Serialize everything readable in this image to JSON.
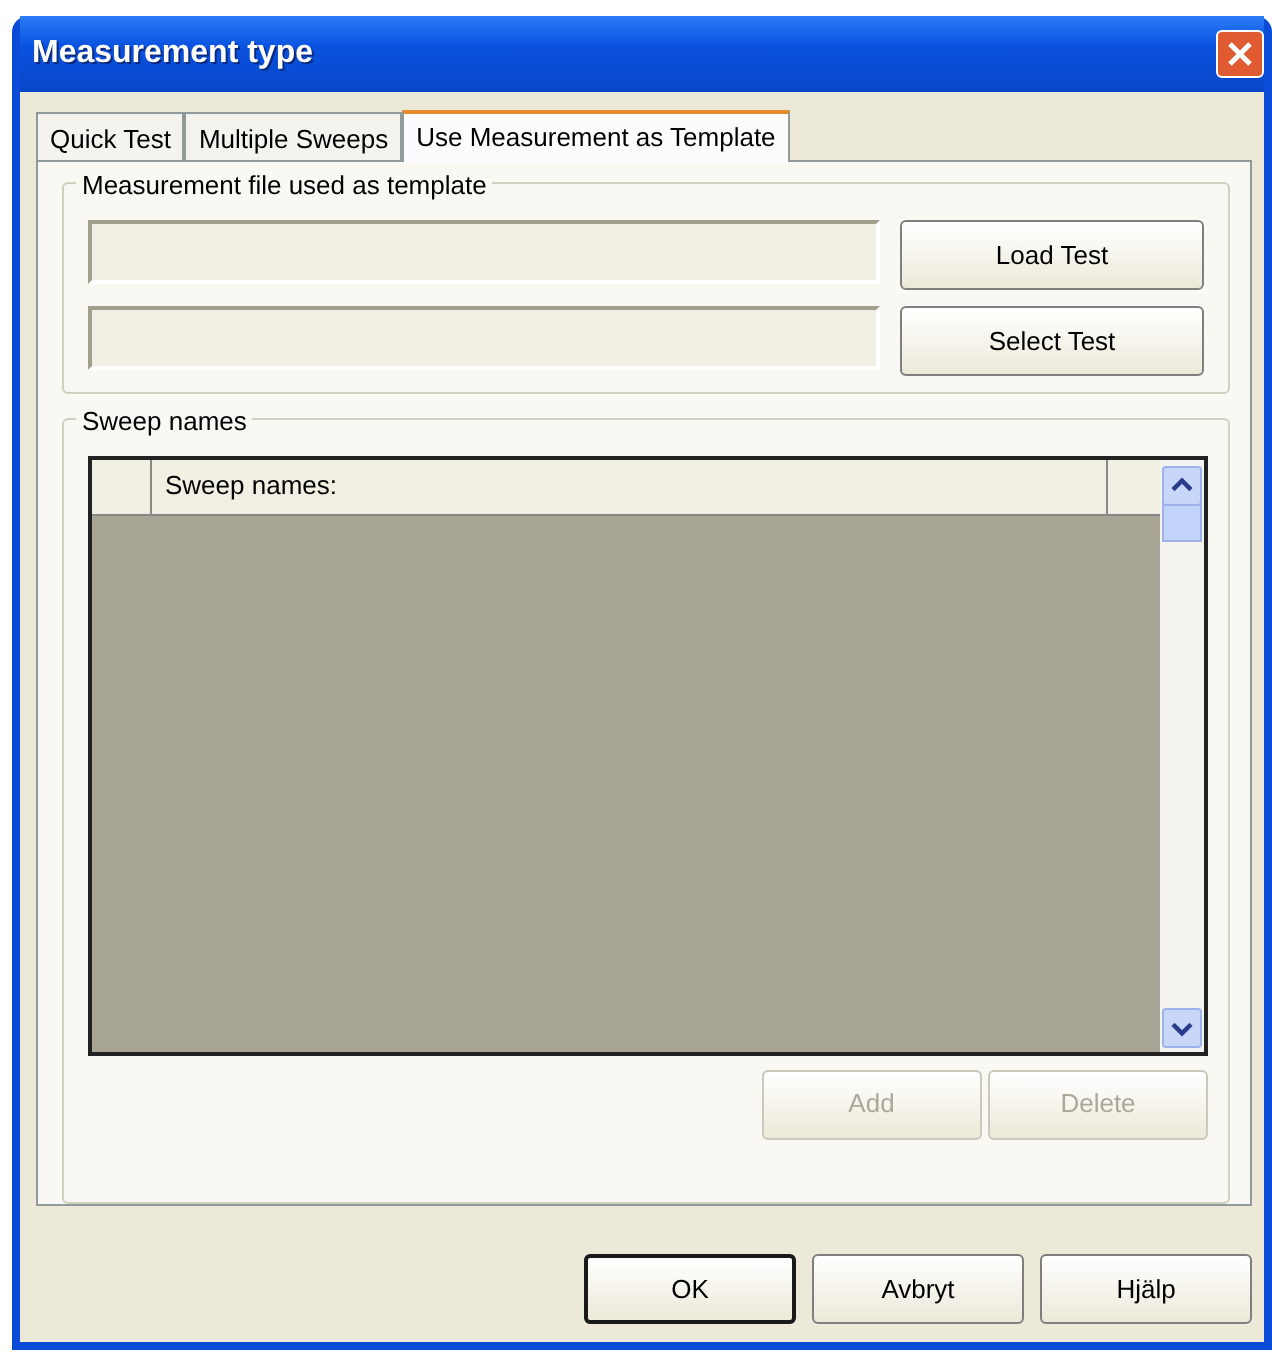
{
  "window": {
    "title": "Measurement type"
  },
  "tabs": [
    {
      "label": "Quick Test",
      "selected": false
    },
    {
      "label": "Multiple Sweeps",
      "selected": false
    },
    {
      "label": "Use Measurement as Template",
      "selected": true
    }
  ],
  "template_group": {
    "legend": "Measurement file used as template",
    "rows": [
      {
        "button": {
          "label": "Load Test",
          "disabled": false
        }
      },
      {
        "button": {
          "label": "Select Test",
          "disabled": false
        }
      }
    ]
  },
  "sweep_group": {
    "legend": "Sweep names",
    "table": {
      "columns": [
        "Sweep names:"
      ]
    },
    "buttons": [
      {
        "label": "Add",
        "disabled": true
      },
      {
        "label": "Delete",
        "disabled": true
      }
    ]
  },
  "dialog_buttons": [
    {
      "label": "OK",
      "default": true
    },
    {
      "label": "Avbryt",
      "default": false
    },
    {
      "label": "Hjälp",
      "default": false
    }
  ]
}
